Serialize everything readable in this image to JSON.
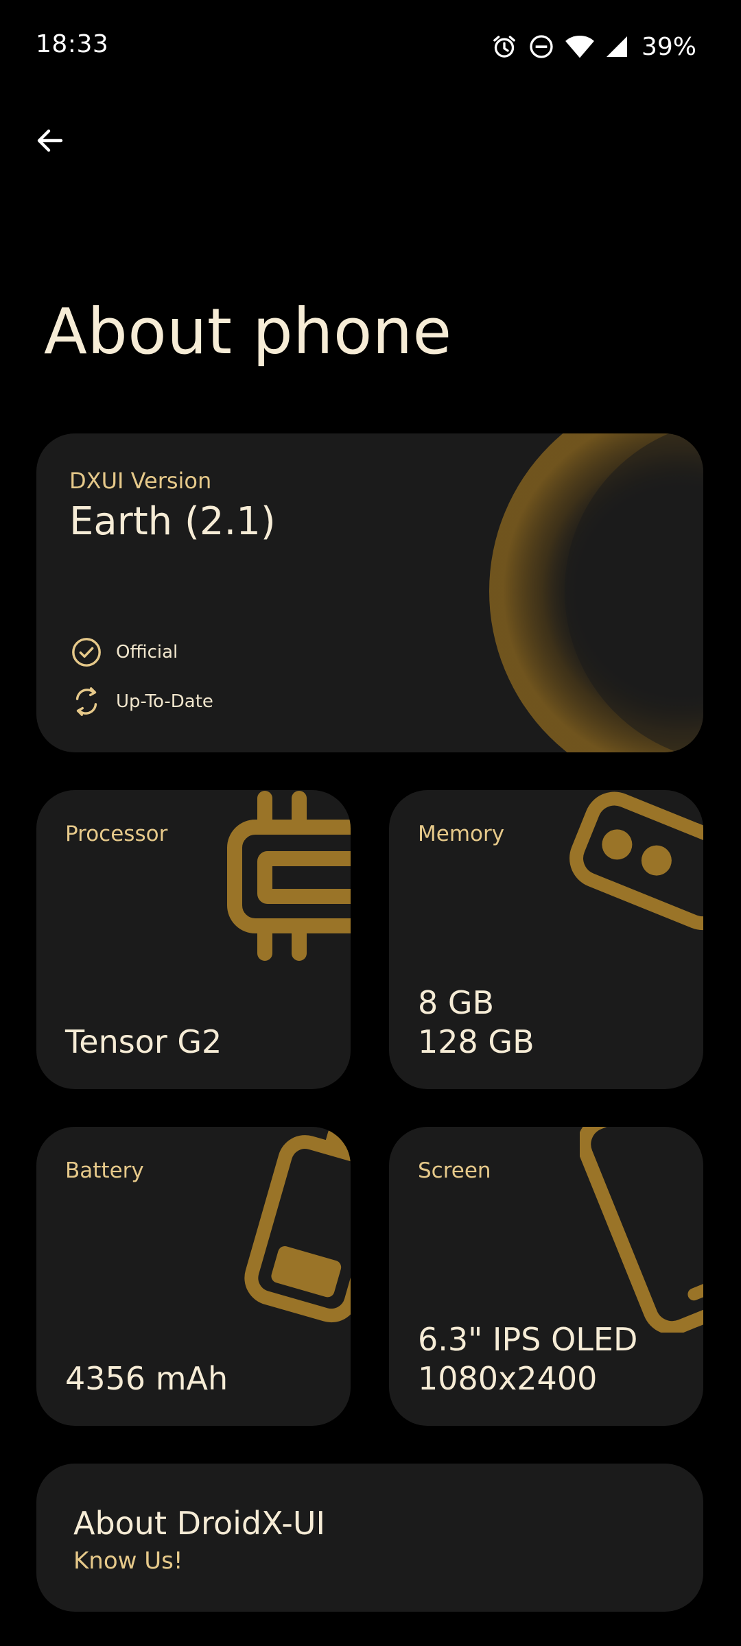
{
  "status_bar": {
    "time": "18:33",
    "battery": "39%",
    "icons": [
      "alarm-icon",
      "do-not-disturb-icon",
      "wifi-icon",
      "signal-icon"
    ]
  },
  "header": {
    "back_icon": "arrow-back-icon",
    "title": "About phone"
  },
  "version_card": {
    "label": "DXUI Version",
    "value": "Earth (2.1)",
    "statuses": [
      {
        "icon": "check-circle-icon",
        "text": "Official"
      },
      {
        "icon": "sync-icon",
        "text": "Up-To-Date"
      }
    ]
  },
  "tiles": {
    "processor": {
      "label": "Processor",
      "value_lines": [
        "Tensor G2"
      ],
      "icon": "chip-icon"
    },
    "memory": {
      "label": "Memory",
      "value_lines": [
        "8 GB",
        "128 GB"
      ],
      "icon": "memory-icon"
    },
    "battery": {
      "label": "Battery",
      "value_lines": [
        "4356 mAh"
      ],
      "icon": "battery-icon"
    },
    "screen": {
      "label": "Screen",
      "value_lines": [
        "6.3\" IPS OLED",
        "1080x2400"
      ],
      "icon": "phone-screen-icon"
    }
  },
  "about_card": {
    "title": "About DroidX-UI",
    "subtitle": "Know Us!"
  },
  "colors": {
    "background": "#000000",
    "card": "#1b1b1b",
    "accent": "#9a7428",
    "label": "#e6c98a",
    "text": "#f6ecd6"
  }
}
